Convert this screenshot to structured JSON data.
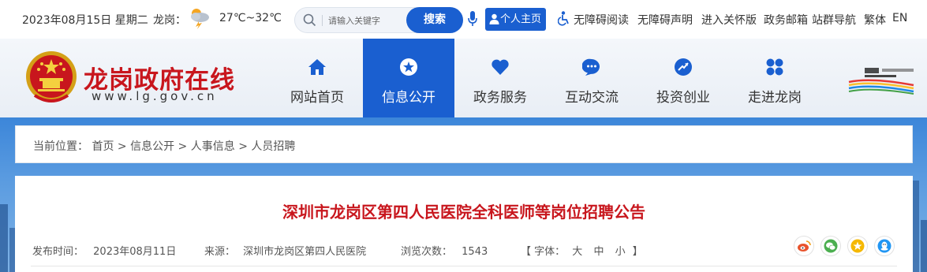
{
  "topbar": {
    "date": "2023年08月15日 星期二",
    "city": "龙岗：",
    "temperature": "27℃~32℃",
    "search_placeholder": "请输入关键字",
    "search_button": "搜索",
    "personal_button": "个人主页",
    "links": [
      "无障碍阅读",
      "无障碍声明",
      "进入关怀版",
      "政务邮箱",
      "站群导航",
      "繁体",
      "EN"
    ]
  },
  "header": {
    "site_title": "龙岗政府在线",
    "site_url": "www.lg.gov.cn",
    "nav": [
      {
        "label": "网站首页",
        "icon": "home-icon"
      },
      {
        "label": "信息公开",
        "icon": "info-star-icon",
        "active": true
      },
      {
        "label": "政务服务",
        "icon": "heart-icon"
      },
      {
        "label": "互动交流",
        "icon": "chat-icon"
      },
      {
        "label": "投资创业",
        "icon": "investment-icon"
      },
      {
        "label": "走进龙岗",
        "icon": "grid-icon"
      }
    ]
  },
  "breadcrumb": {
    "label": "当前位置：",
    "items": [
      "首页",
      "信息公开",
      "人事信息",
      "人员招聘"
    ],
    "separator": ">"
  },
  "article": {
    "title": "深圳市龙岗区第四人民医院全科医师等岗位招聘公告",
    "publish_label": "发布时间：",
    "publish_date": "2023年08月11日",
    "source_label": "来源：",
    "source": "深圳市龙岗区第四人民医院",
    "views_label": "浏览次数：",
    "views": "1543",
    "font_label": "【 字体：",
    "font_options": [
      "大",
      "中",
      "小"
    ],
    "font_close": "】"
  },
  "colors": {
    "primary_blue": "#1a5fd0",
    "title_red": "#c8161d"
  }
}
